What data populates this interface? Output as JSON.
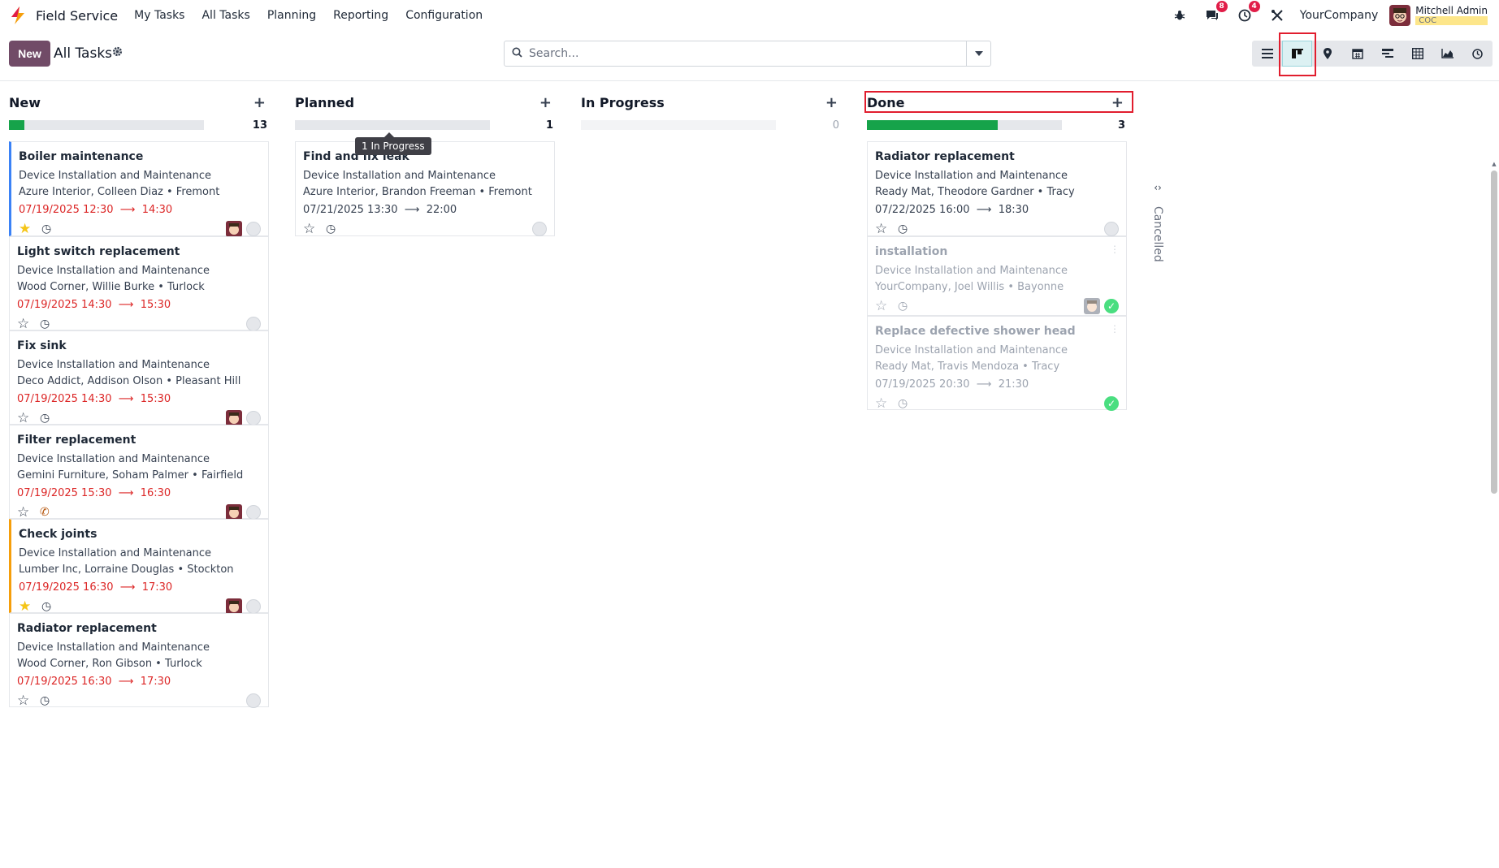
{
  "navbar": {
    "app_name": "Field Service",
    "menu": [
      "My Tasks",
      "All Tasks",
      "Planning",
      "Reporting",
      "Configuration"
    ],
    "messages_badge": "8",
    "activities_badge": "4",
    "company": "YourCompany",
    "user_name": "Mitchell Admin",
    "user_db": "COC"
  },
  "control": {
    "new_label": "New",
    "title": "All Tasks",
    "search_placeholder": "Search...",
    "views": [
      "list-view",
      "kanban-view",
      "map-view",
      "calendar-view",
      "gantt-view",
      "pivot-view",
      "graph-view",
      "activity-view"
    ]
  },
  "tooltip": "1 In Progress",
  "columns": [
    {
      "title": "New",
      "count": "13",
      "cards": [
        {
          "title": "Boiler maintenance",
          "project": "Device Installation and Maintenance",
          "customer": "Azure Interior, Colleen Diaz • Fremont",
          "start": "07/19/2025 12:30",
          "end": "14:30"
        },
        {
          "title": "Light switch replacement",
          "project": "Device Installation and Maintenance",
          "customer": "Wood Corner, Willie Burke • Turlock",
          "start": "07/19/2025 14:30",
          "end": "15:30"
        },
        {
          "title": "Fix sink",
          "project": "Device Installation and Maintenance",
          "customer": "Deco Addict, Addison Olson • Pleasant Hill",
          "start": "07/19/2025 14:30",
          "end": "15:30"
        },
        {
          "title": "Filter replacement",
          "project": "Device Installation and Maintenance",
          "customer": "Gemini Furniture, Soham Palmer • Fairfield",
          "start": "07/19/2025 15:30",
          "end": "16:30"
        },
        {
          "title": "Check joints",
          "project": "Device Installation and Maintenance",
          "customer": "Lumber Inc, Lorraine Douglas • Stockton",
          "start": "07/19/2025 16:30",
          "end": "17:30"
        },
        {
          "title": "Radiator replacement",
          "project": "Device Installation and Maintenance",
          "customer": "Wood Corner, Ron Gibson • Turlock",
          "start": "07/19/2025 16:30",
          "end": "17:30"
        }
      ]
    },
    {
      "title": "Planned",
      "count": "1",
      "cards": [
        {
          "title": "Find and fix leak",
          "project": "Device Installation and Maintenance",
          "customer": "Azure Interior, Brandon Freeman • Fremont",
          "start": "07/21/2025 13:30",
          "end": "22:00"
        }
      ]
    },
    {
      "title": "In Progress",
      "count": "0",
      "cards": []
    },
    {
      "title": "Done",
      "count": "3",
      "cards": [
        {
          "title": "Radiator replacement",
          "project": "Device Installation and Maintenance",
          "customer": "Ready Mat, Theodore Gardner • Tracy",
          "start": "07/22/2025 16:00",
          "end": "18:30"
        },
        {
          "title": "installation",
          "project": "Device Installation and Maintenance",
          "customer": "YourCompany, Joel Willis • Bayonne"
        },
        {
          "title": "Replace defective shower head",
          "project": "Device Installation and Maintenance",
          "customer": "Ready Mat, Travis Mendoza • Tracy",
          "start": "07/19/2025 20:30",
          "end": "21:30"
        }
      ]
    }
  ],
  "folded_column": "Cancelled",
  "progress": {
    "new": 0.08,
    "planned": 0,
    "in_progress": 0,
    "done": 0.67
  },
  "colors": {
    "brand": "#714b67",
    "success": "#16a34a",
    "danger": "#dc2626",
    "highlight": "#e11d2e"
  }
}
